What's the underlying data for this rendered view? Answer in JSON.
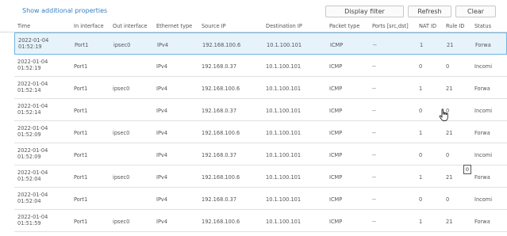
{
  "toolbar": {
    "show_props_label": "Show additional properties",
    "display_filter_label": "Display filter",
    "refresh_label": "Refresh",
    "clear_label": "Clear"
  },
  "columns": [
    "Time",
    "In interface",
    "Out interface",
    "Ethernet type",
    "Source IP",
    "Destination IP",
    "Packet type",
    "Ports [src,dst]",
    "NAT ID",
    "Rule ID",
    "Status"
  ],
  "rows": [
    {
      "date": "2022-01-04",
      "time": "01:52:19",
      "in": "Port1",
      "out": "ipsec0",
      "eth": "IPv4",
      "src": "192.168.100.6",
      "dst": "10.1.100.101",
      "ptype": "ICMP",
      "ports": "--",
      "nat": "1",
      "rule": "21",
      "status": "Forwa",
      "selected": true
    },
    {
      "date": "2022-01-04",
      "time": "01:52:19",
      "in": "Port1",
      "out": "",
      "eth": "IPv4",
      "src": "192.168.0.37",
      "dst": "10.1.100.101",
      "ptype": "ICMP",
      "ports": "--",
      "nat": "0",
      "rule": "0",
      "status": "Incomi",
      "selected": false
    },
    {
      "date": "2022-01-04",
      "time": "01:52:14",
      "in": "Port1",
      "out": "ipsec0",
      "eth": "IPv4",
      "src": "192.168.100.6",
      "dst": "10.1.100.101",
      "ptype": "ICMP",
      "ports": "--",
      "nat": "1",
      "rule": "21",
      "status": "Forwa",
      "selected": false
    },
    {
      "date": "2022-01-04",
      "time": "01:52:14",
      "in": "Port1",
      "out": "",
      "eth": "IPv4",
      "src": "192.168.0.37",
      "dst": "10.1.100.101",
      "ptype": "ICMP",
      "ports": "--",
      "nat": "0",
      "rule": "0",
      "status": "Incomi",
      "selected": false
    },
    {
      "date": "2022-01-04",
      "time": "01:52:09",
      "in": "Port1",
      "out": "ipsec0",
      "eth": "IPv4",
      "src": "192.168.100.6",
      "dst": "10.1.100.101",
      "ptype": "ICMP",
      "ports": "--",
      "nat": "1",
      "rule": "21",
      "status": "Forwa",
      "selected": false
    },
    {
      "date": "2022-01-04",
      "time": "01:52:09",
      "in": "Port1",
      "out": "",
      "eth": "IPv4",
      "src": "192.168.0.37",
      "dst": "10.1.100.101",
      "ptype": "ICMP",
      "ports": "--",
      "nat": "0",
      "rule": "0",
      "status": "Incomi",
      "selected": false
    },
    {
      "date": "2022-01-04",
      "time": "01:52:04",
      "in": "Port1",
      "out": "ipsec0",
      "eth": "IPv4",
      "src": "192.168.100.6",
      "dst": "10.1.100.101",
      "ptype": "ICMP",
      "ports": "--",
      "nat": "1",
      "rule": "21",
      "status": "Forwa",
      "selected": false
    },
    {
      "date": "2022-01-04",
      "time": "01:52:04",
      "in": "Port1",
      "out": "",
      "eth": "IPv4",
      "src": "192.168.0.37",
      "dst": "10.1.100.101",
      "ptype": "ICMP",
      "ports": "--",
      "nat": "0",
      "rule": "0",
      "status": "Incomi",
      "selected": false
    },
    {
      "date": "2022-01-04",
      "time": "01:51:59",
      "in": "Port1",
      "out": "ipsec0",
      "eth": "IPv4",
      "src": "192.168.100.6",
      "dst": "10.1.100.101",
      "ptype": "ICMP",
      "ports": "--",
      "nat": "1",
      "rule": "21",
      "status": "Forwa",
      "selected": false
    }
  ],
  "tooltip": "0",
  "icons": {
    "cursor": "hand-pointer-icon"
  },
  "colors": {
    "link": "#3a7fc1",
    "selected_bg": "#e6f3fb",
    "selected_border": "#6fb6e1"
  }
}
